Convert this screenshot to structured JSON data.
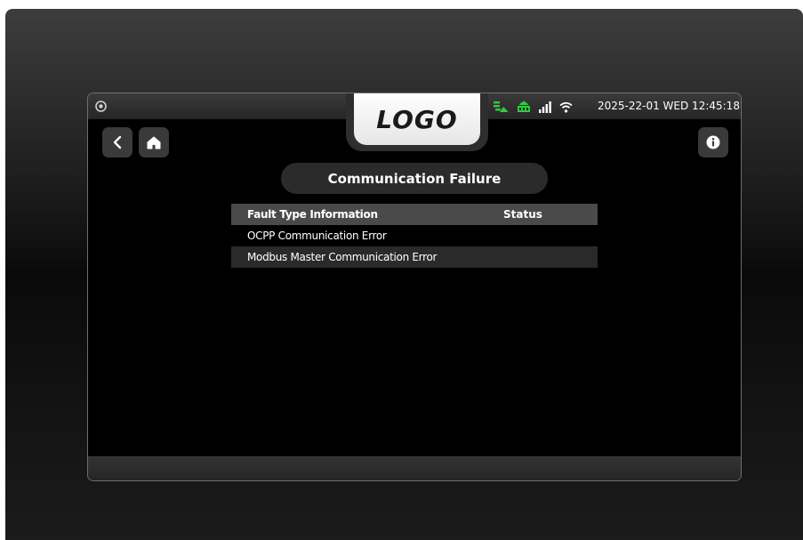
{
  "header": {
    "logo_text": "LOGO",
    "datetime": "2025-22-01 WED 12:45:18",
    "status_icons": [
      "network-status-icon",
      "charger-status-icon",
      "signal-strength-icon",
      "wifi-icon"
    ],
    "status_icon_color": "#2ecc40"
  },
  "nav": {
    "back_icon": "chevron-left-icon",
    "home_icon": "home-icon",
    "info_icon": "info-icon"
  },
  "page": {
    "title": "Communication Failure"
  },
  "fault_table": {
    "columns": [
      "Fault Type Information",
      "Status"
    ],
    "rows": [
      {
        "fault": "OCPP Communication Error",
        "status": ""
      },
      {
        "fault": "Modbus Master Communication Error",
        "status": ""
      }
    ]
  }
}
